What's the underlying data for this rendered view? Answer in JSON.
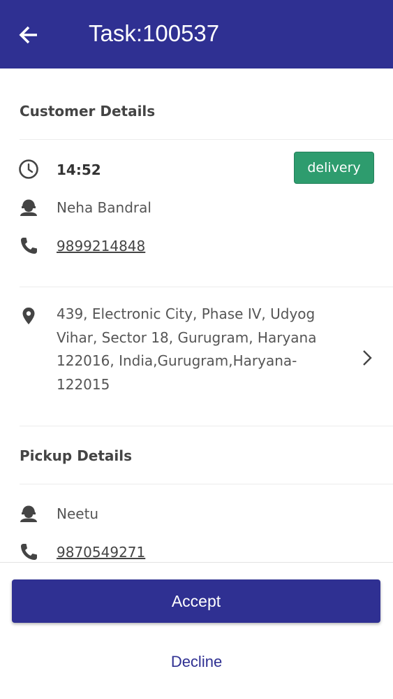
{
  "header": {
    "title": "Task:100537",
    "back_icon": "arrow-left-icon",
    "background_color": "#2f3092"
  },
  "customer": {
    "section_title": "Customer Details",
    "time": "14:52",
    "time_icon": "clock-icon",
    "task_type": "delivery",
    "task_type_color": "#2e9c6e",
    "name": "Neha Bandral",
    "name_icon": "person-icon",
    "phone": "9899214848",
    "phone_icon": "phone-icon",
    "address_lines": [
      "439, Electronic City, Phase IV, Udyog",
      "Vihar, Sector 18, Gurugram, Haryana",
      "122016, India,Gurugram,Haryana-",
      "122015"
    ],
    "address_icon": "location-pin-icon",
    "address_chevron_icon": "chevron-right-icon"
  },
  "pickup": {
    "section_title": "Pickup Details",
    "name": "Neetu",
    "name_icon": "person-icon",
    "phone": "9870549271",
    "phone_icon": "phone-icon"
  },
  "actions": {
    "accept_label": "Accept",
    "decline_label": "Decline",
    "accent_color": "#2f3092"
  }
}
